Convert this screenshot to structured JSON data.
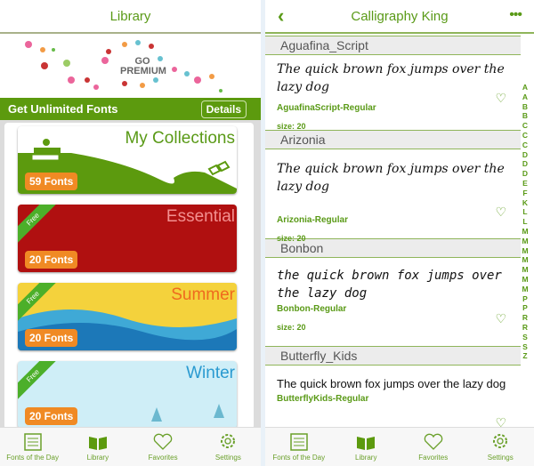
{
  "left": {
    "title": "Library",
    "banner_text": "GO PREMIUM",
    "promo": {
      "label": "Get Unlimited Fonts",
      "button": "Details"
    },
    "cards": [
      {
        "title": "My Collections",
        "count": "59 Fonts",
        "free": "",
        "bg": "#5c9a0e",
        "title_color": "#5a9a17"
      },
      {
        "title": "Essential",
        "count": "20 Fonts",
        "free": "Free",
        "bg": "#b01010",
        "title_color": "#f39090"
      },
      {
        "title": "Summer",
        "count": "20 Fonts",
        "free": "Free",
        "bg": "#f4d23c",
        "title_color": "#ef6a1e"
      },
      {
        "title": "Winter",
        "count": "20 Fonts",
        "free": "Free",
        "bg": "#cfeef7",
        "title_color": "#2a9ad0"
      }
    ]
  },
  "right": {
    "title": "Calligraphy King",
    "sections": [
      {
        "header": "Aguafina_Script",
        "sample": "The quick brown fox jumps over the lazy dog",
        "font": "AguafinaScript-Regular",
        "size": "size: 20"
      },
      {
        "header": "Arizonia",
        "sample": "The quick brown fox jumps over the lazy dog",
        "font": "Arizonia-Regular",
        "size": "size: 20"
      },
      {
        "header": "Bonbon",
        "sample": "the quick brown fox jumps over the lazy dog",
        "font": "Bonbon-Regular",
        "size": "size: 20"
      },
      {
        "header": "Butterfly_Kids",
        "sample": "The quick brown fox jumps over the lazy dog",
        "font": "ButterflyKids-Regular",
        "size": ""
      }
    ],
    "index": [
      "A",
      "A",
      "B",
      "B",
      "C",
      "C",
      "C",
      "D",
      "D",
      "D",
      "E",
      "F",
      "K",
      "L",
      "L",
      "M",
      "M",
      "M",
      "M",
      "M",
      "M",
      "M",
      "P",
      "P",
      "R",
      "R",
      "S",
      "S",
      "Z"
    ]
  },
  "tabbar": {
    "items": [
      {
        "label": "Fonts of the Day",
        "icon": "list-icon"
      },
      {
        "label": "Library",
        "icon": "book-icon"
      },
      {
        "label": "Favorites",
        "icon": "heart-icon"
      },
      {
        "label": "Settings",
        "icon": "gear-icon"
      }
    ]
  },
  "colors": {
    "accent": "#5a9a17",
    "badge": "#f08a24"
  }
}
